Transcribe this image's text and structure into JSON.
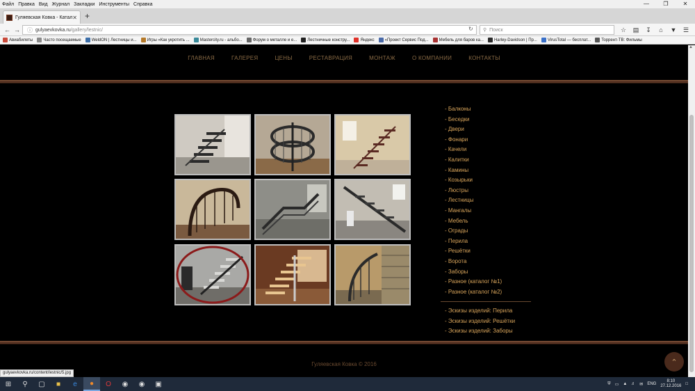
{
  "menubar": [
    "Файл",
    "Правка",
    "Вид",
    "Журнал",
    "Закладки",
    "Инструменты",
    "Справка"
  ],
  "tab": {
    "title": "Гуляевская Ковка - Катал..."
  },
  "url": {
    "domain": "gulyaevkovka.ru",
    "path": "/gallery/lestnic/"
  },
  "search": {
    "placeholder": "Поиск"
  },
  "bookmarks": [
    "Авиабилеты",
    "Часто посещаемые",
    "WeldON | Лестницы и...",
    "Игры «Как укротить ...",
    "Mastercity.ru - альбо...",
    "Форум о металле и е...",
    "Лестничные констру...",
    "Яндекс",
    "«Проект Сервис Под...",
    "Мебель для баров ка...",
    "Harley-Davidson | Пр...",
    "VirusTotal — бесплат...",
    "Торрент-ТВ: Фильмы"
  ],
  "sitenav": [
    "ГЛАВНАЯ",
    "ГАЛЕРЕЯ",
    "ЦЕНЫ",
    "РЕСТАВРАЦИЯ",
    "МОНТАЖ",
    "О КОМПАНИИ",
    "КОНТАКТЫ"
  ],
  "categories": [
    "- Балконы",
    "- Беседки",
    "- Двери",
    "- Фонари",
    "- Качели",
    "- Калитки",
    "- Камины",
    "- Козырьки",
    "- Люстры",
    "- Лестницы",
    "- Мангалы",
    "- Мебель",
    "- Ограды",
    "- Перила",
    "- Решётки",
    "- Ворота",
    "- Заборы",
    "- Разное (каталог №1)",
    "- Разное (каталог №2)"
  ],
  "sketches": [
    "- Эскизы изделий: Перила",
    "- Эскизы изделий: Решётки",
    "- Эскизы изделий: Заборы"
  ],
  "footer": "Гуляевская Ковка © 2016",
  "status_url": "gulyaevkovka.ru/content/lestnic/5.jpg",
  "tray": {
    "lang": "ENG",
    "time": "8:10",
    "date": "27.12.2016"
  },
  "colors": {
    "accent": "#d9a55b",
    "stripe": "#5a3524",
    "highlight_ring": "#8b1a1a"
  }
}
